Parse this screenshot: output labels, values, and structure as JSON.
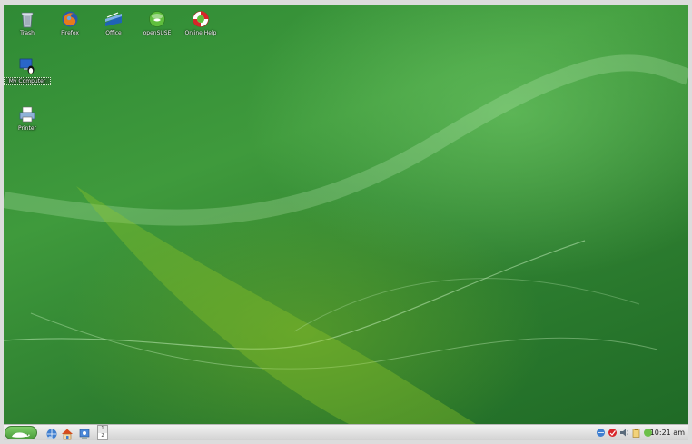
{
  "desktop": {
    "icons": [
      {
        "label": "Trash",
        "icon": "trash-icon"
      },
      {
        "label": "Firefox",
        "icon": "firefox-icon"
      },
      {
        "label": "Office",
        "icon": "office-icon"
      },
      {
        "label": "openSUSE",
        "icon": "opensuse-icon"
      },
      {
        "label": "Online Help",
        "icon": "lifebuoy-help-icon"
      },
      {
        "label": "My Computer",
        "icon": "computer-tux-icon"
      },
      {
        "label": "Printer",
        "icon": "printer-icon"
      }
    ]
  },
  "taskbar": {
    "start_menu": {
      "icon": "opensuse-gecko-icon"
    },
    "quick_launch": [
      {
        "icon": "network-icon"
      },
      {
        "icon": "home-folder-icon"
      },
      {
        "icon": "control-center-icon"
      }
    ],
    "pager": {
      "desktops": [
        "1",
        "2"
      ],
      "active": "1"
    },
    "tray_icons": [
      "network-manager-icon",
      "updater-icon",
      "audio-icon",
      "clipboard-icon",
      "power-icon"
    ],
    "clock": "10:21 am"
  }
}
